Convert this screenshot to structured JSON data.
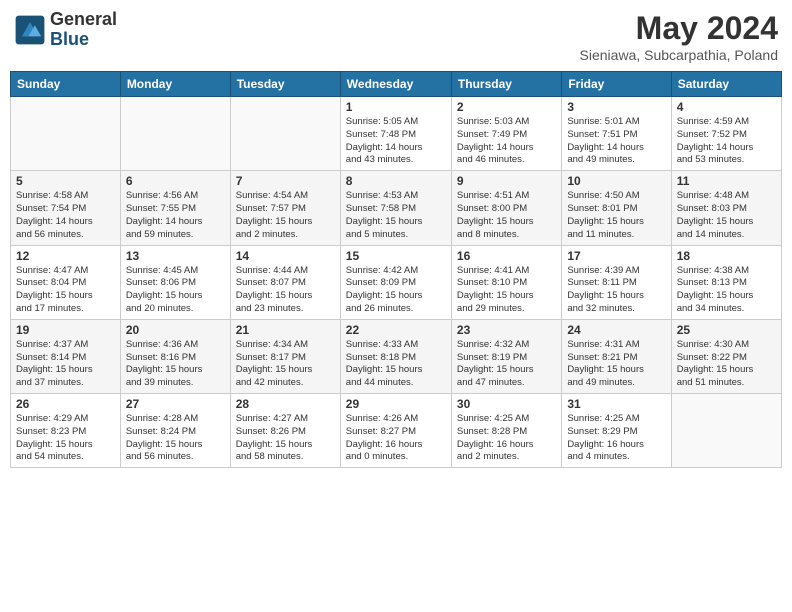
{
  "header": {
    "logo_general": "General",
    "logo_blue": "Blue",
    "month_title": "May 2024",
    "subtitle": "Sieniawa, Subcarpathia, Poland"
  },
  "days_of_week": [
    "Sunday",
    "Monday",
    "Tuesday",
    "Wednesday",
    "Thursday",
    "Friday",
    "Saturday"
  ],
  "weeks": [
    [
      {
        "day": "",
        "info": ""
      },
      {
        "day": "",
        "info": ""
      },
      {
        "day": "",
        "info": ""
      },
      {
        "day": "1",
        "info": "Sunrise: 5:05 AM\nSunset: 7:48 PM\nDaylight: 14 hours\nand 43 minutes."
      },
      {
        "day": "2",
        "info": "Sunrise: 5:03 AM\nSunset: 7:49 PM\nDaylight: 14 hours\nand 46 minutes."
      },
      {
        "day": "3",
        "info": "Sunrise: 5:01 AM\nSunset: 7:51 PM\nDaylight: 14 hours\nand 49 minutes."
      },
      {
        "day": "4",
        "info": "Sunrise: 4:59 AM\nSunset: 7:52 PM\nDaylight: 14 hours\nand 53 minutes."
      }
    ],
    [
      {
        "day": "5",
        "info": "Sunrise: 4:58 AM\nSunset: 7:54 PM\nDaylight: 14 hours\nand 56 minutes."
      },
      {
        "day": "6",
        "info": "Sunrise: 4:56 AM\nSunset: 7:55 PM\nDaylight: 14 hours\nand 59 minutes."
      },
      {
        "day": "7",
        "info": "Sunrise: 4:54 AM\nSunset: 7:57 PM\nDaylight: 15 hours\nand 2 minutes."
      },
      {
        "day": "8",
        "info": "Sunrise: 4:53 AM\nSunset: 7:58 PM\nDaylight: 15 hours\nand 5 minutes."
      },
      {
        "day": "9",
        "info": "Sunrise: 4:51 AM\nSunset: 8:00 PM\nDaylight: 15 hours\nand 8 minutes."
      },
      {
        "day": "10",
        "info": "Sunrise: 4:50 AM\nSunset: 8:01 PM\nDaylight: 15 hours\nand 11 minutes."
      },
      {
        "day": "11",
        "info": "Sunrise: 4:48 AM\nSunset: 8:03 PM\nDaylight: 15 hours\nand 14 minutes."
      }
    ],
    [
      {
        "day": "12",
        "info": "Sunrise: 4:47 AM\nSunset: 8:04 PM\nDaylight: 15 hours\nand 17 minutes."
      },
      {
        "day": "13",
        "info": "Sunrise: 4:45 AM\nSunset: 8:06 PM\nDaylight: 15 hours\nand 20 minutes."
      },
      {
        "day": "14",
        "info": "Sunrise: 4:44 AM\nSunset: 8:07 PM\nDaylight: 15 hours\nand 23 minutes."
      },
      {
        "day": "15",
        "info": "Sunrise: 4:42 AM\nSunset: 8:09 PM\nDaylight: 15 hours\nand 26 minutes."
      },
      {
        "day": "16",
        "info": "Sunrise: 4:41 AM\nSunset: 8:10 PM\nDaylight: 15 hours\nand 29 minutes."
      },
      {
        "day": "17",
        "info": "Sunrise: 4:39 AM\nSunset: 8:11 PM\nDaylight: 15 hours\nand 32 minutes."
      },
      {
        "day": "18",
        "info": "Sunrise: 4:38 AM\nSunset: 8:13 PM\nDaylight: 15 hours\nand 34 minutes."
      }
    ],
    [
      {
        "day": "19",
        "info": "Sunrise: 4:37 AM\nSunset: 8:14 PM\nDaylight: 15 hours\nand 37 minutes."
      },
      {
        "day": "20",
        "info": "Sunrise: 4:36 AM\nSunset: 8:16 PM\nDaylight: 15 hours\nand 39 minutes."
      },
      {
        "day": "21",
        "info": "Sunrise: 4:34 AM\nSunset: 8:17 PM\nDaylight: 15 hours\nand 42 minutes."
      },
      {
        "day": "22",
        "info": "Sunrise: 4:33 AM\nSunset: 8:18 PM\nDaylight: 15 hours\nand 44 minutes."
      },
      {
        "day": "23",
        "info": "Sunrise: 4:32 AM\nSunset: 8:19 PM\nDaylight: 15 hours\nand 47 minutes."
      },
      {
        "day": "24",
        "info": "Sunrise: 4:31 AM\nSunset: 8:21 PM\nDaylight: 15 hours\nand 49 minutes."
      },
      {
        "day": "25",
        "info": "Sunrise: 4:30 AM\nSunset: 8:22 PM\nDaylight: 15 hours\nand 51 minutes."
      }
    ],
    [
      {
        "day": "26",
        "info": "Sunrise: 4:29 AM\nSunset: 8:23 PM\nDaylight: 15 hours\nand 54 minutes."
      },
      {
        "day": "27",
        "info": "Sunrise: 4:28 AM\nSunset: 8:24 PM\nDaylight: 15 hours\nand 56 minutes."
      },
      {
        "day": "28",
        "info": "Sunrise: 4:27 AM\nSunset: 8:26 PM\nDaylight: 15 hours\nand 58 minutes."
      },
      {
        "day": "29",
        "info": "Sunrise: 4:26 AM\nSunset: 8:27 PM\nDaylight: 16 hours\nand 0 minutes."
      },
      {
        "day": "30",
        "info": "Sunrise: 4:25 AM\nSunset: 8:28 PM\nDaylight: 16 hours\nand 2 minutes."
      },
      {
        "day": "31",
        "info": "Sunrise: 4:25 AM\nSunset: 8:29 PM\nDaylight: 16 hours\nand 4 minutes."
      },
      {
        "day": "",
        "info": ""
      }
    ]
  ]
}
